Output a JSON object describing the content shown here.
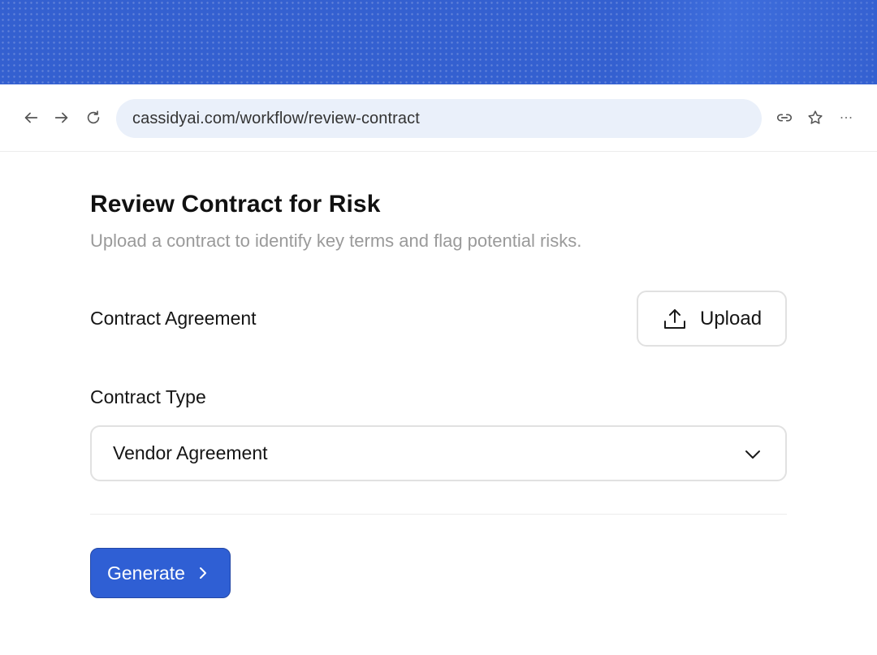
{
  "browser": {
    "url": "cassidyai.com/workflow/review-contract"
  },
  "page": {
    "title": "Review Contract for Risk",
    "subtitle": "Upload a contract to identify key terms and flag potential risks."
  },
  "form": {
    "contract_agreement_label": "Contract Agreement",
    "upload_label": "Upload",
    "contract_type_label": "Contract Type",
    "contract_type_value": "Vendor Agreement",
    "generate_label": "Generate"
  },
  "icons": {
    "back": "arrow-left-icon",
    "forward": "arrow-right-icon",
    "reload": "reload-icon",
    "link": "link-icon",
    "bookmark": "star-icon",
    "more": "more-icon",
    "upload": "upload-icon",
    "dropdown": "chevron-down-icon",
    "generate": "chevron-right-icon"
  },
  "colors": {
    "banner": "#3460d0",
    "address_bar": "#eaf0fa",
    "primary_button": "#2f5fd4",
    "subtitle_text": "#9a9a9a"
  }
}
